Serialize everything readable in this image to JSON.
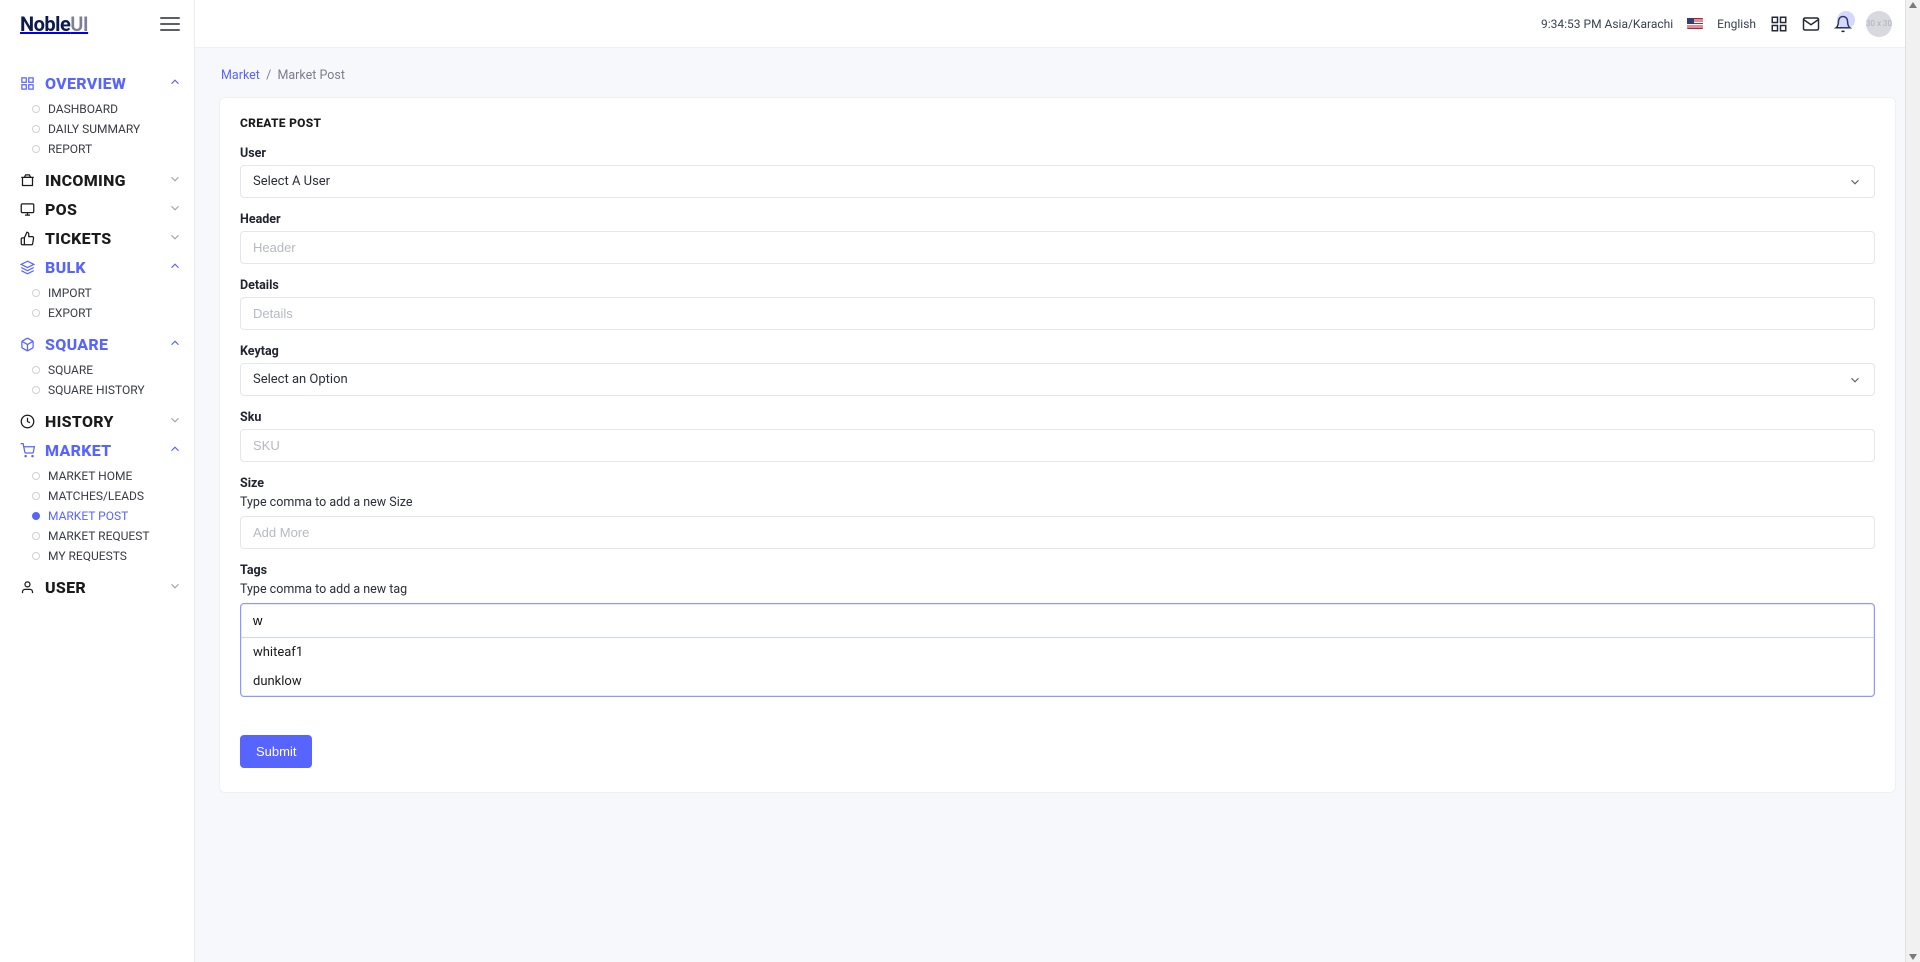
{
  "brand": {
    "strong": "Noble",
    "light": "UI"
  },
  "sidebar": {
    "overview": {
      "label": "OVERVIEW",
      "items": [
        "DASHBOARD",
        "DAILY SUMMARY",
        "REPORT"
      ]
    },
    "incoming": "INCOMING",
    "pos": "POS",
    "tickets": "TICKETS",
    "bulk": {
      "label": "BULK",
      "items": [
        "IMPORT",
        "EXPORT"
      ]
    },
    "square": {
      "label": "SQUARE",
      "items": [
        "SQUARE",
        "SQUARE HISTORY"
      ]
    },
    "history": "HISTORY",
    "market": {
      "label": "MARKET",
      "items": [
        "MARKET HOME",
        "MATCHES/LEADS",
        "MARKET POST",
        "MARKET REQUEST",
        "MY REQUESTS"
      ]
    },
    "user": "USER"
  },
  "topbar": {
    "clock": "9:34:53 PM Asia/Karachi",
    "lang": "English",
    "avatar": "30 x 30"
  },
  "breadcrumb": {
    "root": "Market",
    "sep": "/",
    "current": "Market Post"
  },
  "form": {
    "title": "CREATE POST",
    "user": {
      "label": "User",
      "value": "Select A User"
    },
    "header": {
      "label": "Header",
      "placeholder": "Header"
    },
    "details": {
      "label": "Details",
      "placeholder": "Details"
    },
    "keytag": {
      "label": "Keytag",
      "value": "Select an Option"
    },
    "sku": {
      "label": "Sku",
      "placeholder": "SKU"
    },
    "size": {
      "label": "Size",
      "hint": "Type comma to add a new Size",
      "placeholder": "Add More"
    },
    "tags": {
      "label": "Tags",
      "hint": "Type comma to add a new tag",
      "value": "w",
      "options": [
        "whiteaf1",
        "dunklow"
      ]
    },
    "submit": "Submit"
  }
}
